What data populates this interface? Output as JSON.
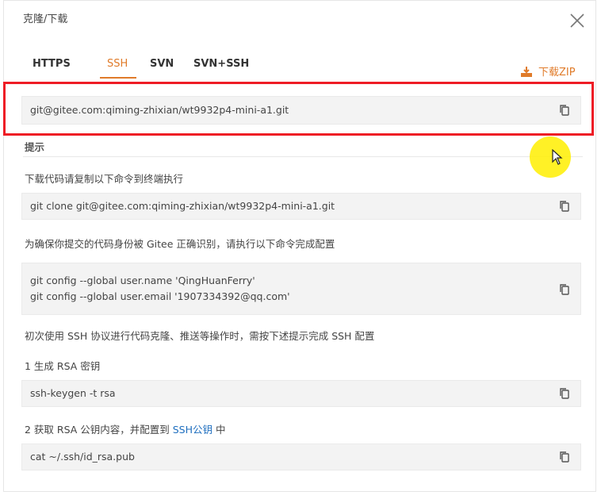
{
  "dialog": {
    "title": "克隆/下载"
  },
  "tabs": [
    {
      "label": "HTTPS",
      "active": false
    },
    {
      "label": "SSH",
      "active": true
    },
    {
      "label": "SVN",
      "active": false
    },
    {
      "label": "SVN+SSH",
      "active": false
    }
  ],
  "download": {
    "label": "下载ZIP",
    "icon": "download-icon"
  },
  "repo_url": "git@gitee.com:qiming-zhixian/wt9932p4-mini-a1.git",
  "tip_heading": "提示",
  "steps": {
    "clone_label": "下载代码请复制以下命令到终端执行",
    "clone_command": "git clone git@gitee.com:qiming-zhixian/wt9932p4-mini-a1.git",
    "config_label": "为确保你提交的代码身份被 Gitee 正确识别，请执行以下命令完成配置",
    "config_line1": "git config --global user.name 'QingHuanFerry'",
    "config_line2": "git config --global user.email '1907334392@qq.com'",
    "ssh_intro": "初次使用 SSH 协议进行代码克隆、推送等操作时，需按下述提示完成 SSH 配置",
    "step1_label": "1 生成 RSA 密钥",
    "step1_command": "ssh-keygen -t rsa",
    "step2_label_prefix": "2 获取 RSA 公钥内容，并配置到 ",
    "step2_link": "SSH公钥",
    "step2_label_suffix": " 中",
    "step2_command": "cat ~/.ssh/id_rsa.pub"
  },
  "colors": {
    "accent": "#e07b2a",
    "highlight": "#ee1c25",
    "link": "#1f6fbf"
  }
}
